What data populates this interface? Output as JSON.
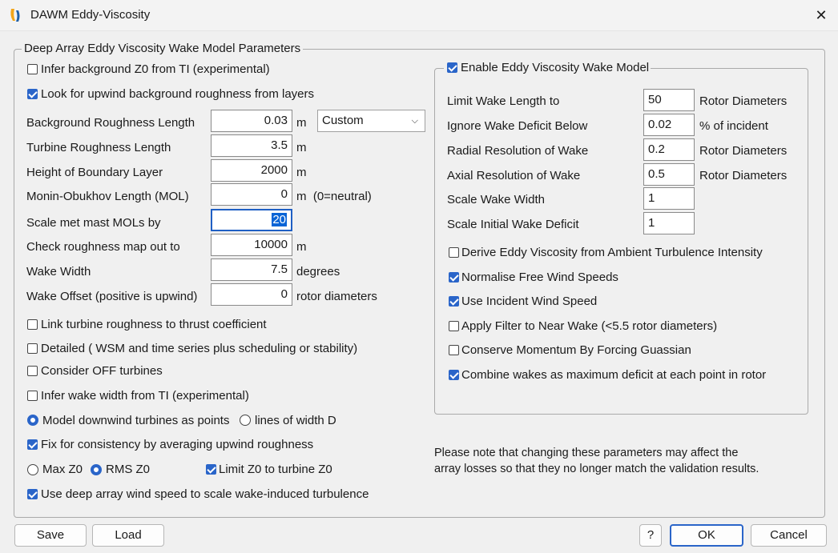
{
  "window": {
    "title": "DAWM Eddy-Viscosity",
    "close_glyph": "✕"
  },
  "left_group": {
    "legend": "Deep Array Eddy Viscosity Wake Model Parameters",
    "infer_z0": {
      "label": "Infer background Z0 from TI (experimental)",
      "checked": false
    },
    "look_upwind": {
      "label": "Look for upwind background roughness from layers",
      "checked": true
    },
    "fields": [
      {
        "label": "Background Roughness Length",
        "value": "0.03",
        "unit": "m"
      },
      {
        "label": "Turbine Roughness Length",
        "value": "3.5",
        "unit": "m"
      },
      {
        "label": "Height of Boundary Layer",
        "value": "2000",
        "unit": "m"
      },
      {
        "label": "Monin-Obukhov Length (MOL)",
        "value": "0",
        "unit": "m  (0=neutral)"
      },
      {
        "label": "Scale met mast MOLs by",
        "value": "20",
        "unit": ""
      },
      {
        "label": "Check roughness map out to",
        "value": "10000",
        "unit": "m"
      },
      {
        "label": "Wake Width",
        "value": "7.5",
        "unit": "degrees"
      },
      {
        "label": "Wake Offset (positive is upwind)",
        "value": "0",
        "unit": "rotor diameters"
      }
    ],
    "roughness_combo": {
      "value": "Custom"
    },
    "link_roughness": {
      "label": "Link turbine roughness to thrust coefficient",
      "checked": false
    },
    "detailed": {
      "label": "Detailed ( WSM and time series plus scheduling or stability)",
      "checked": false
    },
    "consider_off": {
      "label": "Consider OFF turbines",
      "checked": false
    },
    "infer_wake_width": {
      "label": "Infer wake width from TI (experimental)",
      "checked": false
    },
    "model_points": {
      "label": "Model downwind turbines as points",
      "selected": true
    },
    "lines_width": {
      "label": "lines of width D",
      "selected": false
    },
    "fix_consistency": {
      "label": "Fix for consistency by averaging upwind roughness",
      "checked": true
    },
    "max_z0": {
      "label": "Max Z0",
      "selected": false
    },
    "rms_z0": {
      "label": "RMS Z0",
      "selected": true
    },
    "limit_z0": {
      "label": "Limit Z0 to turbine Z0",
      "checked": true
    },
    "use_deep_array": {
      "label": "Use deep array wind speed to scale wake-induced turbulence",
      "checked": true
    }
  },
  "right_group": {
    "enable": {
      "label": "Enable Eddy Viscosity Wake Model",
      "checked": true
    },
    "fields": [
      {
        "label": "Limit Wake Length to",
        "value": "50",
        "unit": "Rotor Diameters"
      },
      {
        "label": "Ignore Wake Deficit Below",
        "value": "0.02",
        "unit": "% of incident"
      },
      {
        "label": "Radial Resolution of Wake",
        "value": "0.2",
        "unit": "Rotor Diameters"
      },
      {
        "label": "Axial Resolution of Wake",
        "value": "0.5",
        "unit": "Rotor Diameters"
      },
      {
        "label": "Scale Wake Width",
        "value": "1",
        "unit": ""
      },
      {
        "label": "Scale Initial Wake Deficit",
        "value": "1",
        "unit": ""
      }
    ],
    "derive": {
      "label": "Derive Eddy Viscosity from Ambient Turbulence Intensity",
      "checked": false
    },
    "normalise": {
      "label": "Normalise Free Wind Speeds",
      "checked": true
    },
    "incident": {
      "label": "Use Incident Wind Speed",
      "checked": true
    },
    "filter": {
      "label": "Apply Filter to Near Wake (<5.5 rotor diameters)",
      "checked": false
    },
    "conserve": {
      "label": "Conserve Momentum By Forcing Guassian",
      "checked": false
    },
    "combine": {
      "label": "Combine wakes as maximum deficit at each point in rotor",
      "checked": true
    }
  },
  "note": {
    "line1": "Please note that changing these parameters may affect the",
    "line2": "array losses so that they no longer match the validation results."
  },
  "buttons": {
    "save": "Save",
    "load": "Load",
    "help": "?",
    "ok": "OK",
    "cancel": "Cancel"
  }
}
